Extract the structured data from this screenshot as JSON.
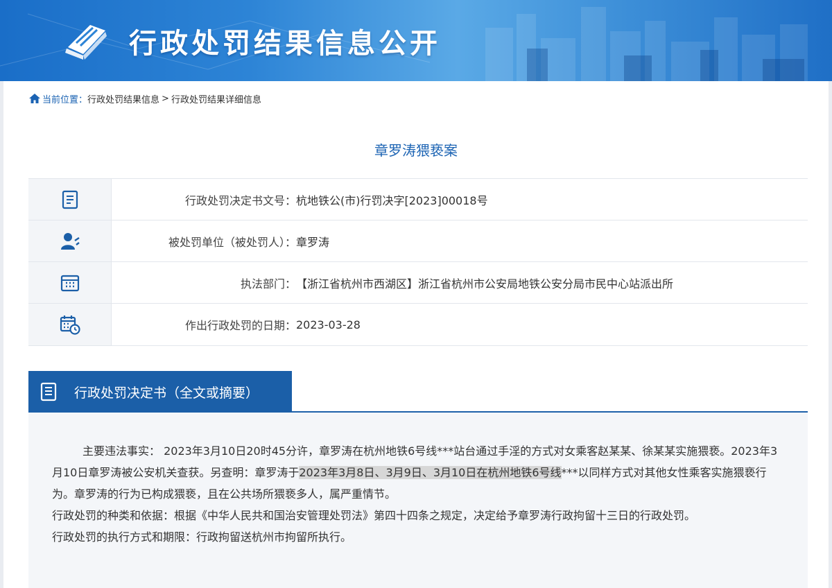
{
  "header": {
    "title": "行政处罚结果信息公开"
  },
  "breadcrumb": {
    "current_label": "当前位置：",
    "level1": "行政处罚结果信息",
    "separator": ">",
    "level2": "行政处罚结果详细信息"
  },
  "case": {
    "title": "章罗涛猥亵案"
  },
  "info": [
    {
      "icon": "document-number-icon",
      "label": "行政处罚决定书文号：",
      "value": "杭地铁公(市)行罚决字[2023]00018号"
    },
    {
      "icon": "person-icon",
      "label": "被处罚单位（被处罚人）：",
      "value": "章罗涛"
    },
    {
      "icon": "building-icon",
      "label": "执法部门：",
      "value": "【浙江省杭州市西湖区】浙江省杭州市公安局地铁公安分局市民中心站派出所"
    },
    {
      "icon": "calendar-clock-icon",
      "label": "作出行政处罚的日期：",
      "value": "2023-03-28"
    }
  ],
  "decision": {
    "tab_label": "行政处罚决定书（全文或摘要）",
    "para1_a": "主要违法事实：  2023年3月10日20时45分许，章罗涛在杭州地铁6号线***站台通过手淫的方式对女乘客赵某某、徐某某实施猥亵。2023年3月10日章罗涛被公安机关查获。另查明：章罗涛于",
    "para1_highlight": "2023年3月8日、3月9日、3月10日在杭州地铁6号线",
    "para1_b": "***以同样方式对其他女性乘客实施猥亵行为。章罗涛的行为已构成猥亵，且在公共场所猥亵多人，属严重情节。",
    "para2": "行政处罚的种类和依据：根据《中华人民共和国治安管理处罚法》第四十四条之规定，决定给予章罗涛行政拘留十三日的行政处罚。",
    "para3": "行政处罚的执行方式和期限：行政拘留送杭州市拘留所执行。"
  },
  "colors": {
    "accent": "#1b5fa8",
    "link": "#1b63b3",
    "banner": "#2d84d6"
  }
}
